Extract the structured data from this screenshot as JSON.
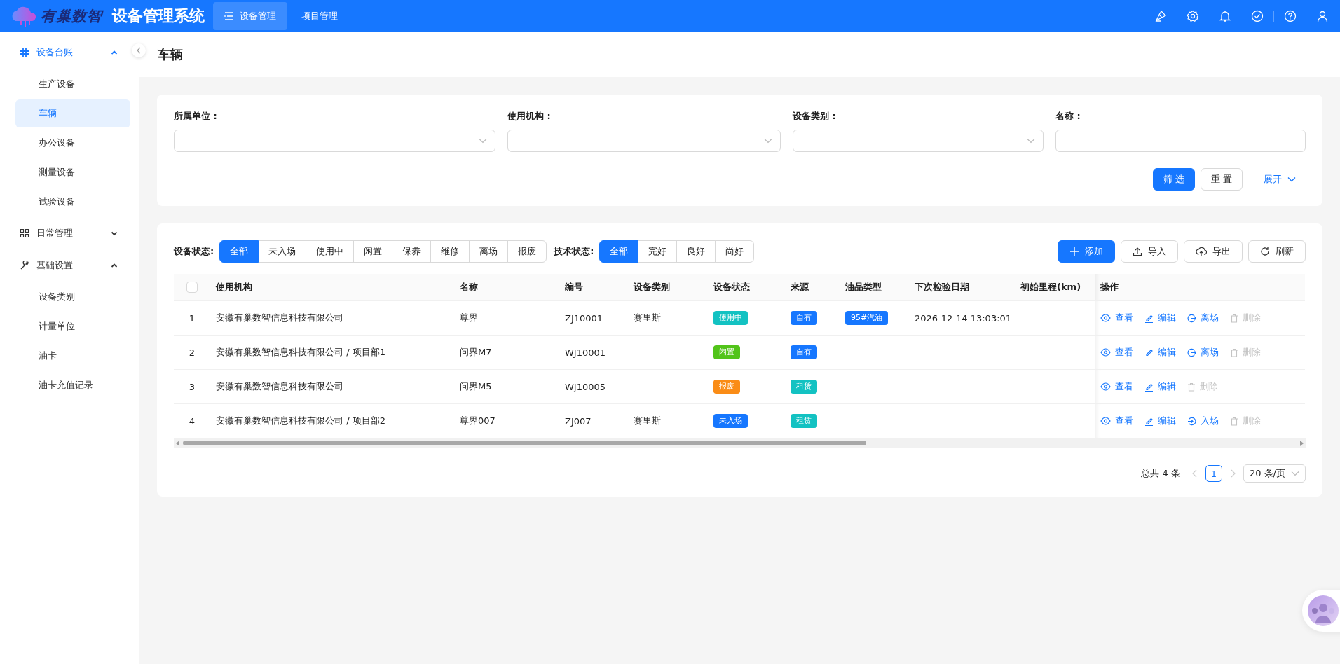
{
  "header": {
    "logo_text": "有巢数智",
    "app_title": "设备管理系统",
    "nav": [
      {
        "label": "设备管理",
        "selected": true
      },
      {
        "label": "项目管理",
        "selected": false
      }
    ]
  },
  "sidebar": {
    "groups": [
      {
        "label": "设备台账",
        "expanded": true,
        "children": [
          {
            "label": "生产设备",
            "selected": false
          },
          {
            "label": "车辆",
            "selected": true
          },
          {
            "label": "办公设备",
            "selected": false
          },
          {
            "label": "测量设备",
            "selected": false
          },
          {
            "label": "试验设备",
            "selected": false
          }
        ]
      },
      {
        "label": "日常管理",
        "expanded": false
      },
      {
        "label": "基础设置",
        "expanded": true,
        "children": [
          {
            "label": "设备类别",
            "selected": false
          },
          {
            "label": "计量单位",
            "selected": false
          },
          {
            "label": "油卡",
            "selected": false
          },
          {
            "label": "油卡充值记录",
            "selected": false
          }
        ]
      }
    ]
  },
  "page_title": "车辆",
  "filters": [
    {
      "label": "所属单位 :",
      "kind": "select"
    },
    {
      "label": "使用机构 :",
      "kind": "select"
    },
    {
      "label": "设备类别 :",
      "kind": "select"
    },
    {
      "label": "名称 :",
      "kind": "input"
    }
  ],
  "filter_buttons": [
    {
      "label": "筛 选",
      "kind": "primary"
    },
    {
      "label": "重 置",
      "kind": "default"
    },
    {
      "label": "展开",
      "kind": "link"
    }
  ],
  "status_filters": [
    {
      "label": "设备状态:",
      "options": [
        {
          "label": "全部",
          "selected": true
        },
        {
          "label": "未入场",
          "selected": false
        },
        {
          "label": "使用中",
          "selected": false
        },
        {
          "label": "闲置",
          "selected": false
        },
        {
          "label": "保养",
          "selected": false
        },
        {
          "label": "维修",
          "selected": false
        },
        {
          "label": "离场",
          "selected": false
        },
        {
          "label": "报废",
          "selected": false
        }
      ]
    },
    {
      "label": "技术状态:",
      "options": [
        {
          "label": "全部",
          "selected": true
        },
        {
          "label": "完好",
          "selected": false
        },
        {
          "label": "良好",
          "selected": false
        },
        {
          "label": "尚好",
          "selected": false
        }
      ]
    }
  ],
  "toolbar_buttons": [
    {
      "label": "添加",
      "kind": "add"
    },
    {
      "label": "导入",
      "kind": "import"
    },
    {
      "label": "导出",
      "kind": "export"
    },
    {
      "label": "刷新",
      "kind": "refresh"
    }
  ],
  "table": {
    "select_all": {
      "checked": false
    },
    "columns": [
      "使用机构",
      "名称",
      "编号",
      "设备类别",
      "设备状态",
      "来源",
      "油品类型",
      "下次检验日期",
      "初始里程(km)",
      "操作"
    ],
    "rows": [
      {
        "index": "1",
        "org": "安徽有巢数智信息科技有限公司",
        "name": "尊界",
        "code": "ZJ10001",
        "category": "赛里斯",
        "status": {
          "text": "使用中",
          "color": "#13c2c2"
        },
        "source": {
          "text": "自有",
          "color": "#1677ff"
        },
        "fuel": {
          "text": "95#汽油",
          "color": "#1677ff"
        },
        "next_inspection": "2026-12-14 13:03:01",
        "actions": [
          {
            "label": "查看",
            "kind": "view",
            "disabled": false
          },
          {
            "label": "编辑",
            "kind": "edit",
            "disabled": false
          },
          {
            "label": "离场",
            "kind": "leave",
            "disabled": false
          },
          {
            "label": "删除",
            "kind": "delete",
            "disabled": true
          }
        ]
      },
      {
        "index": "2",
        "org": "安徽有巢数智信息科技有限公司 / 项目部1",
        "name": "问界M7",
        "code": "WJ10001",
        "status": {
          "text": "闲置",
          "color": "#52c41a"
        },
        "source": {
          "text": "自有",
          "color": "#1677ff"
        },
        "actions": [
          {
            "label": "查看",
            "kind": "view",
            "disabled": false
          },
          {
            "label": "编辑",
            "kind": "edit",
            "disabled": false
          },
          {
            "label": "离场",
            "kind": "leave",
            "disabled": false
          },
          {
            "label": "删除",
            "kind": "delete",
            "disabled": true
          }
        ]
      },
      {
        "index": "3",
        "org": "安徽有巢数智信息科技有限公司",
        "name": "问界M5",
        "code": "WJ10005",
        "status": {
          "text": "报废",
          "color": "#fa8c16"
        },
        "source": {
          "text": "租赁",
          "color": "#13c2c2"
        },
        "actions": [
          {
            "label": "查看",
            "kind": "view",
            "disabled": false
          },
          {
            "label": "编辑",
            "kind": "edit",
            "disabled": false
          },
          {
            "label": "删除",
            "kind": "delete",
            "disabled": true
          }
        ]
      },
      {
        "index": "4",
        "org": "安徽有巢数智信息科技有限公司 / 项目部2",
        "name": "尊界007",
        "code": "ZJ007",
        "category": "赛里斯",
        "status": {
          "text": "未入场",
          "color": "#1677ff"
        },
        "source": {
          "text": "租赁",
          "color": "#13c2c2"
        },
        "actions": [
          {
            "label": "查看",
            "kind": "view",
            "disabled": false
          },
          {
            "label": "编辑",
            "kind": "edit",
            "disabled": false
          },
          {
            "label": "入场",
            "kind": "enter",
            "disabled": false
          },
          {
            "label": "删除",
            "kind": "delete",
            "disabled": true
          }
        ]
      }
    ]
  },
  "pagination": {
    "total": "总共 4 条",
    "pages": [
      {
        "label": "1",
        "selected": true
      }
    ],
    "page_size": "20 条/页"
  }
}
